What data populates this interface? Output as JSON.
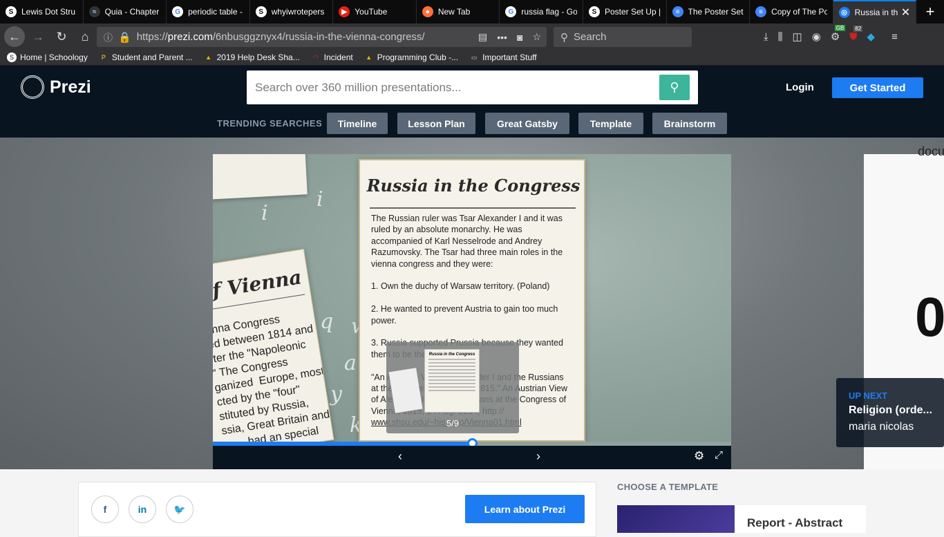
{
  "browser": {
    "tabs": [
      {
        "label": "Lewis Dot Stru",
        "icon": "schoology-icon"
      },
      {
        "label": "Quia - Chapter",
        "icon": "quia-icon"
      },
      {
        "label": "periodic table -",
        "icon": "google-icon"
      },
      {
        "label": "whyiwrotepers",
        "icon": "schoology-icon"
      },
      {
        "label": "YouTube",
        "icon": "youtube-icon"
      },
      {
        "label": "New Tab",
        "icon": "firefox-icon"
      },
      {
        "label": "russia flag - Go",
        "icon": "google-icon"
      },
      {
        "label": "Poster Set Up |",
        "icon": "schoology-icon"
      },
      {
        "label": "The Poster Set",
        "icon": "docs-icon"
      },
      {
        "label": "Copy of The Po",
        "icon": "docs-icon"
      },
      {
        "label": "Russia in th",
        "icon": "prezi-icon",
        "active": true
      }
    ],
    "url_prefix": "https://",
    "url_domain": "prezi.com",
    "url_path": "/6nbusggznyx4/russia-in-the-vienna-congress/",
    "search_placeholder": "Search",
    "badge_count": "82",
    "badge_gb": "GB",
    "bookmarks": [
      "Home | Schoology",
      "Student and Parent ...",
      "2019 Help Desk Sha...",
      "Incident",
      "Programming Club -...",
      "Important Stuff"
    ]
  },
  "header": {
    "logo": "Prezi",
    "search_placeholder": "Search over 360 million presentations...",
    "login": "Login",
    "get_started": "Get Started",
    "trending_label": "TRENDING SEARCHES",
    "trending": [
      "Timeline",
      "Lesson Plan",
      "Great Gatsby",
      "Template",
      "Brainstorm"
    ]
  },
  "slide": {
    "title": "Russia in the Congress",
    "body_lines": [
      "The Russian ruler was Tsar Alexander I and it was",
      "ruled by an absolute monarchy. He was",
      "accompanied of Karl Nesselrode and Andrey",
      "Razumovsky. The Tsar had three main roles in the",
      "vienna congress and they were:",
      "",
      "1. Own the duchy of Warsaw territory. (Poland)",
      "",
      "2. He wanted to prevent Austria to gain too much",
      "power.",
      "",
      "3. Russia supported Prussia because they wanted",
      "them to be their ally. ally.",
      "",
      "\"An Austrian View of Alexander I and the Russians",
      "at the Congress of Vienna, 1815.\" An Austrian View",
      "of Alexander I and the Russians at the Congress of",
      "Vienna, 1815, 14 Aug. 2014, http://"
    ],
    "body_url": "www.shsu.edu/~his_ncp/Vienna01.html",
    "left_card_title": "of Vienna",
    "left_card_lines": [
      "enna Congress",
      "ed between 1814 and",
      "fter the \"Napoleonic",
      "\" The Congress",
      "ganized  Europe, mostly",
      "cted by the \"four\"",
      "stituted by Russia,",
      "ssia, Great Britain and",
      "        had an special"
    ],
    "preview_thumb_title": "Russia in the Congress",
    "slide_counter": "5/9",
    "progress_fraction": 0.5
  },
  "right_panel": {
    "big_text": "0",
    "snippet": "docu"
  },
  "up_next": {
    "label": "UP NEXT",
    "title": "Religion (orde...",
    "author": "maria nicolas"
  },
  "footer": {
    "learn_button": "Learn about Prezi",
    "choose_template": "CHOOSE A TEMPLATE",
    "template_name": "Report - Abstract"
  },
  "colors": {
    "accent": "#1e7cf2",
    "header_bg": "#091421",
    "search_go": "#3cb59a"
  }
}
